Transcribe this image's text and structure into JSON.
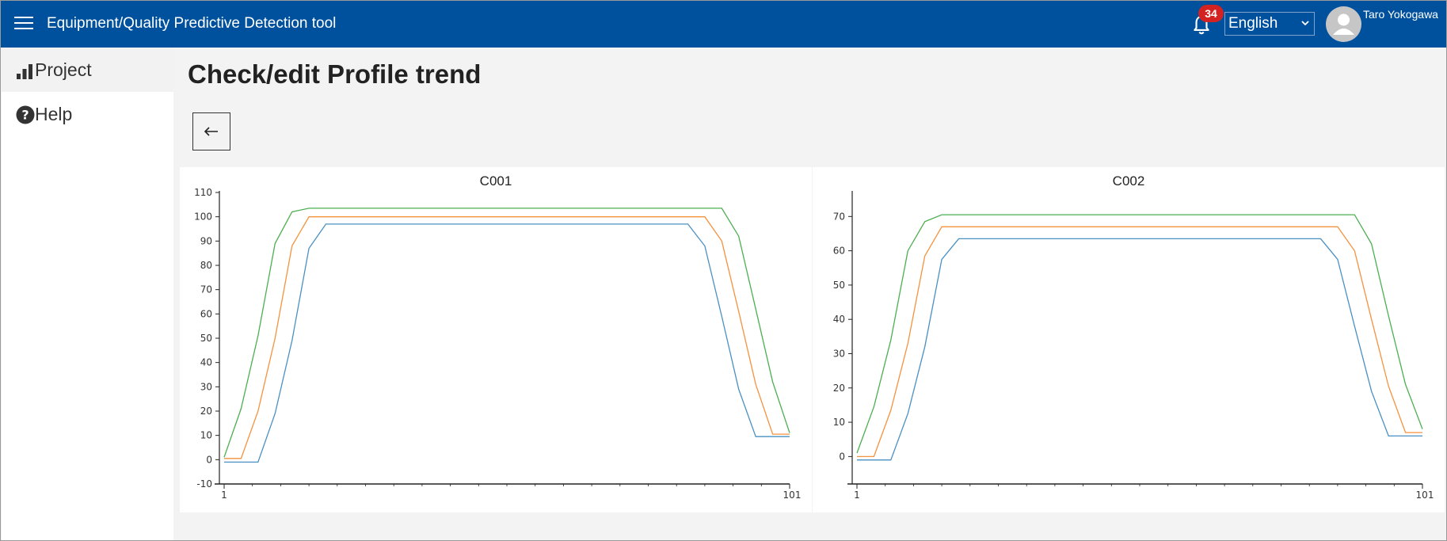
{
  "header": {
    "app_title": "Equipment/Quality Predictive Detection tool",
    "notification_count": "34",
    "language": "English",
    "user_name": "Taro Yokogawa",
    "background_color": "#00519d",
    "badge_color": "#d32222"
  },
  "sidebar": {
    "items": [
      {
        "label": "Project",
        "icon": "bar-chart-icon",
        "active": true
      },
      {
        "label": "Help",
        "icon": "help-circle-icon",
        "active": false
      }
    ]
  },
  "main": {
    "page_title": "Check/edit Profile trend",
    "back_button_icon": "arrow-left-icon"
  },
  "chart_data": [
    {
      "type": "line",
      "title": "C001",
      "xlim": [
        1,
        101
      ],
      "ylim": [
        -10,
        110
      ],
      "yticks": [
        -10,
        0,
        10,
        20,
        30,
        40,
        50,
        60,
        70,
        80,
        90,
        100,
        110
      ],
      "xtick_labels": [
        "1",
        "101"
      ],
      "series": [
        {
          "color": "#4a90c2",
          "points": [
            [
              1,
              -1
            ],
            [
              7,
              -1
            ],
            [
              10,
              19
            ],
            [
              13,
              49
            ],
            [
              16,
              87
            ],
            [
              19,
              97
            ],
            [
              83,
              97
            ],
            [
              86,
              88
            ],
            [
              89,
              59
            ],
            [
              92,
              29
            ],
            [
              95,
              9.5
            ],
            [
              101,
              9.5
            ]
          ]
        },
        {
          "color": "#f5923e",
          "points": [
            [
              1,
              0.5
            ],
            [
              4,
              0.5
            ],
            [
              7,
              20
            ],
            [
              10,
              50
            ],
            [
              13,
              88
            ],
            [
              16,
              100
            ],
            [
              86,
              100
            ],
            [
              89,
              90
            ],
            [
              92,
              61
            ],
            [
              95,
              31
            ],
            [
              98,
              10.5
            ],
            [
              101,
              10.5
            ]
          ]
        },
        {
          "color": "#4caf50",
          "points": [
            [
              1,
              1
            ],
            [
              4,
              21
            ],
            [
              7,
              51
            ],
            [
              10,
              89
            ],
            [
              13,
              102
            ],
            [
              16,
              103.5
            ],
            [
              89,
              103.5
            ],
            [
              92,
              92
            ],
            [
              95,
              62
            ],
            [
              98,
              32
            ],
            [
              101,
              11
            ]
          ]
        }
      ]
    },
    {
      "type": "line",
      "title": "C002",
      "xlim": [
        1,
        101
      ],
      "ylim": [
        -8,
        77
      ],
      "yticks": [
        0,
        10,
        20,
        30,
        40,
        50,
        60,
        70
      ],
      "xtick_labels": [
        "1",
        "101"
      ],
      "series": [
        {
          "color": "#4a90c2",
          "points": [
            [
              1,
              -1
            ],
            [
              7,
              -1
            ],
            [
              10,
              12.5
            ],
            [
              13,
              32
            ],
            [
              16,
              57.5
            ],
            [
              19,
              63.5
            ],
            [
              83,
              63.5
            ],
            [
              86,
              57.5
            ],
            [
              89,
              38
            ],
            [
              92,
              19
            ],
            [
              95,
              6
            ],
            [
              101,
              6
            ]
          ]
        },
        {
          "color": "#f5923e",
          "points": [
            [
              1,
              0
            ],
            [
              4,
              0
            ],
            [
              7,
              13.5
            ],
            [
              10,
              33
            ],
            [
              13,
              58.5
            ],
            [
              16,
              67
            ],
            [
              86,
              67
            ],
            [
              89,
              60
            ],
            [
              92,
              40
            ],
            [
              95,
              20.5
            ],
            [
              98,
              7
            ],
            [
              101,
              7
            ]
          ]
        },
        {
          "color": "#4caf50",
          "points": [
            [
              1,
              1
            ],
            [
              4,
              14.5
            ],
            [
              7,
              34
            ],
            [
              10,
              60
            ],
            [
              13,
              68.5
            ],
            [
              16,
              70.5
            ],
            [
              89,
              70.5
            ],
            [
              92,
              62
            ],
            [
              95,
              41
            ],
            [
              98,
              21
            ],
            [
              101,
              8
            ]
          ]
        }
      ]
    }
  ]
}
